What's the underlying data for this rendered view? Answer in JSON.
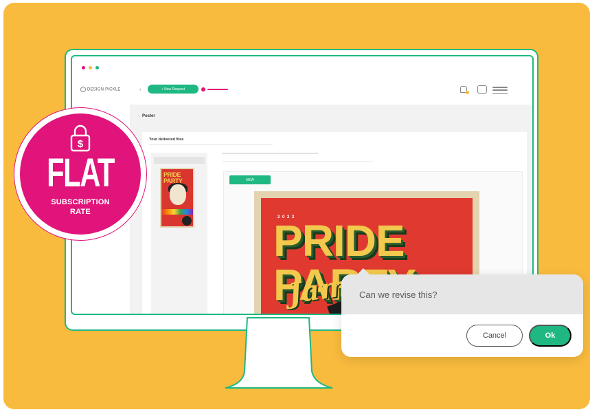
{
  "colors": {
    "background_panel": "#f8bb3e",
    "accent_green": "#1fb883",
    "brand_pink": "#e0147b",
    "dialog_gray": "#e6e6e6"
  },
  "window": {
    "dots": [
      "#e0147b",
      "#f8bb3e",
      "#1fb883"
    ]
  },
  "header": {
    "logo_text": "DESIGN PICKLE",
    "new_request_label": "+ New Request",
    "icons": [
      "bell-icon",
      "user-icon",
      "menu-icon"
    ]
  },
  "breadcrumb": {
    "title": "Poster"
  },
  "files": {
    "title": "Your delivered files",
    "new_tag": "NEW",
    "thumbnail_title": "PRIDE PARTY"
  },
  "poster": {
    "ribbon": "2 0 2 2",
    "title": "PRIDE PARTY",
    "script": "Jam"
  },
  "badge": {
    "headline": "FLAT",
    "line1": "SUBSCRIPTION",
    "line2": "RATE",
    "icon": "lock-dollar-icon"
  },
  "dialog": {
    "message": "Can we revise this?",
    "cancel_label": "Cancel",
    "ok_label": "Ok"
  }
}
